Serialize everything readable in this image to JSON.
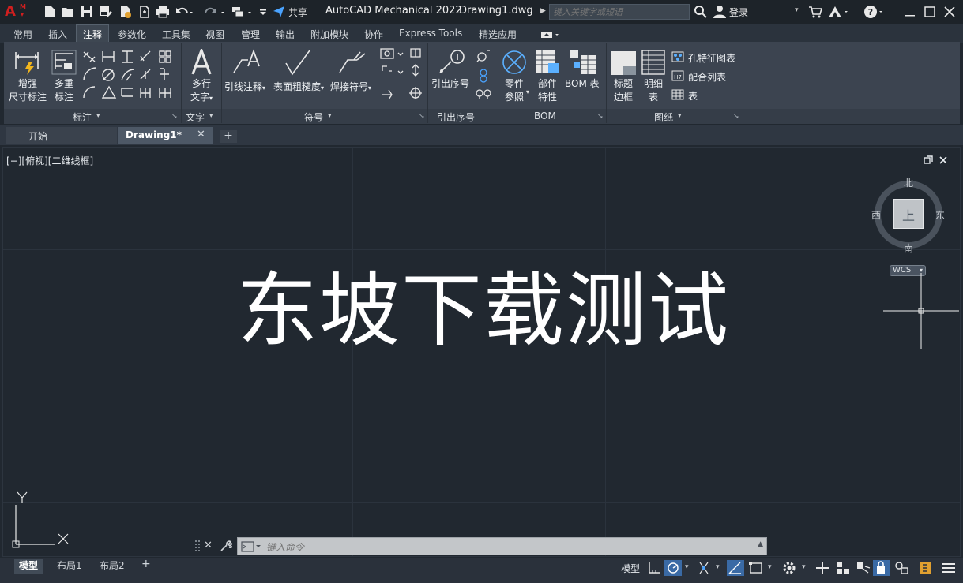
{
  "app": {
    "logo_letter": "A",
    "logo_badge": "M",
    "product": "AutoCAD Mechanical 2022",
    "document": "Drawing1.dwg",
    "share_label": "共享",
    "search_placeholder": "键入关键字或短语",
    "login_label": "登录"
  },
  "ribbon_tabs": [
    "常用",
    "插入",
    "注释",
    "参数化",
    "工具集",
    "视图",
    "管理",
    "输出",
    "附加模块",
    "协作",
    "Express Tools",
    "精选应用"
  ],
  "active_tab": "注释",
  "panels": {
    "dimension": {
      "title": "标注",
      "enhanced_dim_l1": "增强",
      "enhanced_dim_l2": "尺寸标注",
      "multi_dim_l1": "多重",
      "multi_dim_l2": "标注"
    },
    "text": {
      "title": "文字",
      "mtext_l1": "多行",
      "mtext_l2": "文字"
    },
    "symbol": {
      "title": "符号",
      "leader": "引线注释",
      "surface": "表面粗糙度",
      "weld": "焊接符号"
    },
    "balloon": {
      "title": "引出序号",
      "balloon": "引出序号"
    },
    "bom": {
      "title": "BOM",
      "part_ref_l1": "零件",
      "part_ref_l2": "参照",
      "part_prop_l1": "部件",
      "part_prop_l2": "特性",
      "bom_table": "BOM 表"
    },
    "drawing": {
      "title": "图纸",
      "title_border_l1": "标题",
      "title_border_l2": "边框",
      "detail_l1": "明细",
      "detail_l2": "表",
      "hole_chart": "孔特征图表",
      "fit_list": "配合列表",
      "table": "表"
    }
  },
  "file_tabs": {
    "start": "开始",
    "drawing": "Drawing1*"
  },
  "viewport": {
    "label": "[−][俯视][二维线框]",
    "watermark": "东坡下载测试",
    "viewcube": {
      "north": "北",
      "south": "南",
      "east": "东",
      "west": "西",
      "top": "上",
      "wcs": "WCS"
    }
  },
  "command_line": {
    "placeholder": "键入命令"
  },
  "layout_tabs": {
    "model": "模型",
    "layout1": "布局1",
    "layout2": "布局2"
  },
  "status": {
    "model": "模型"
  },
  "colors": {
    "background": "#212830",
    "ribbon": "#3c4450",
    "accent": "#3a6aa5",
    "logo": "#d01f1f"
  }
}
